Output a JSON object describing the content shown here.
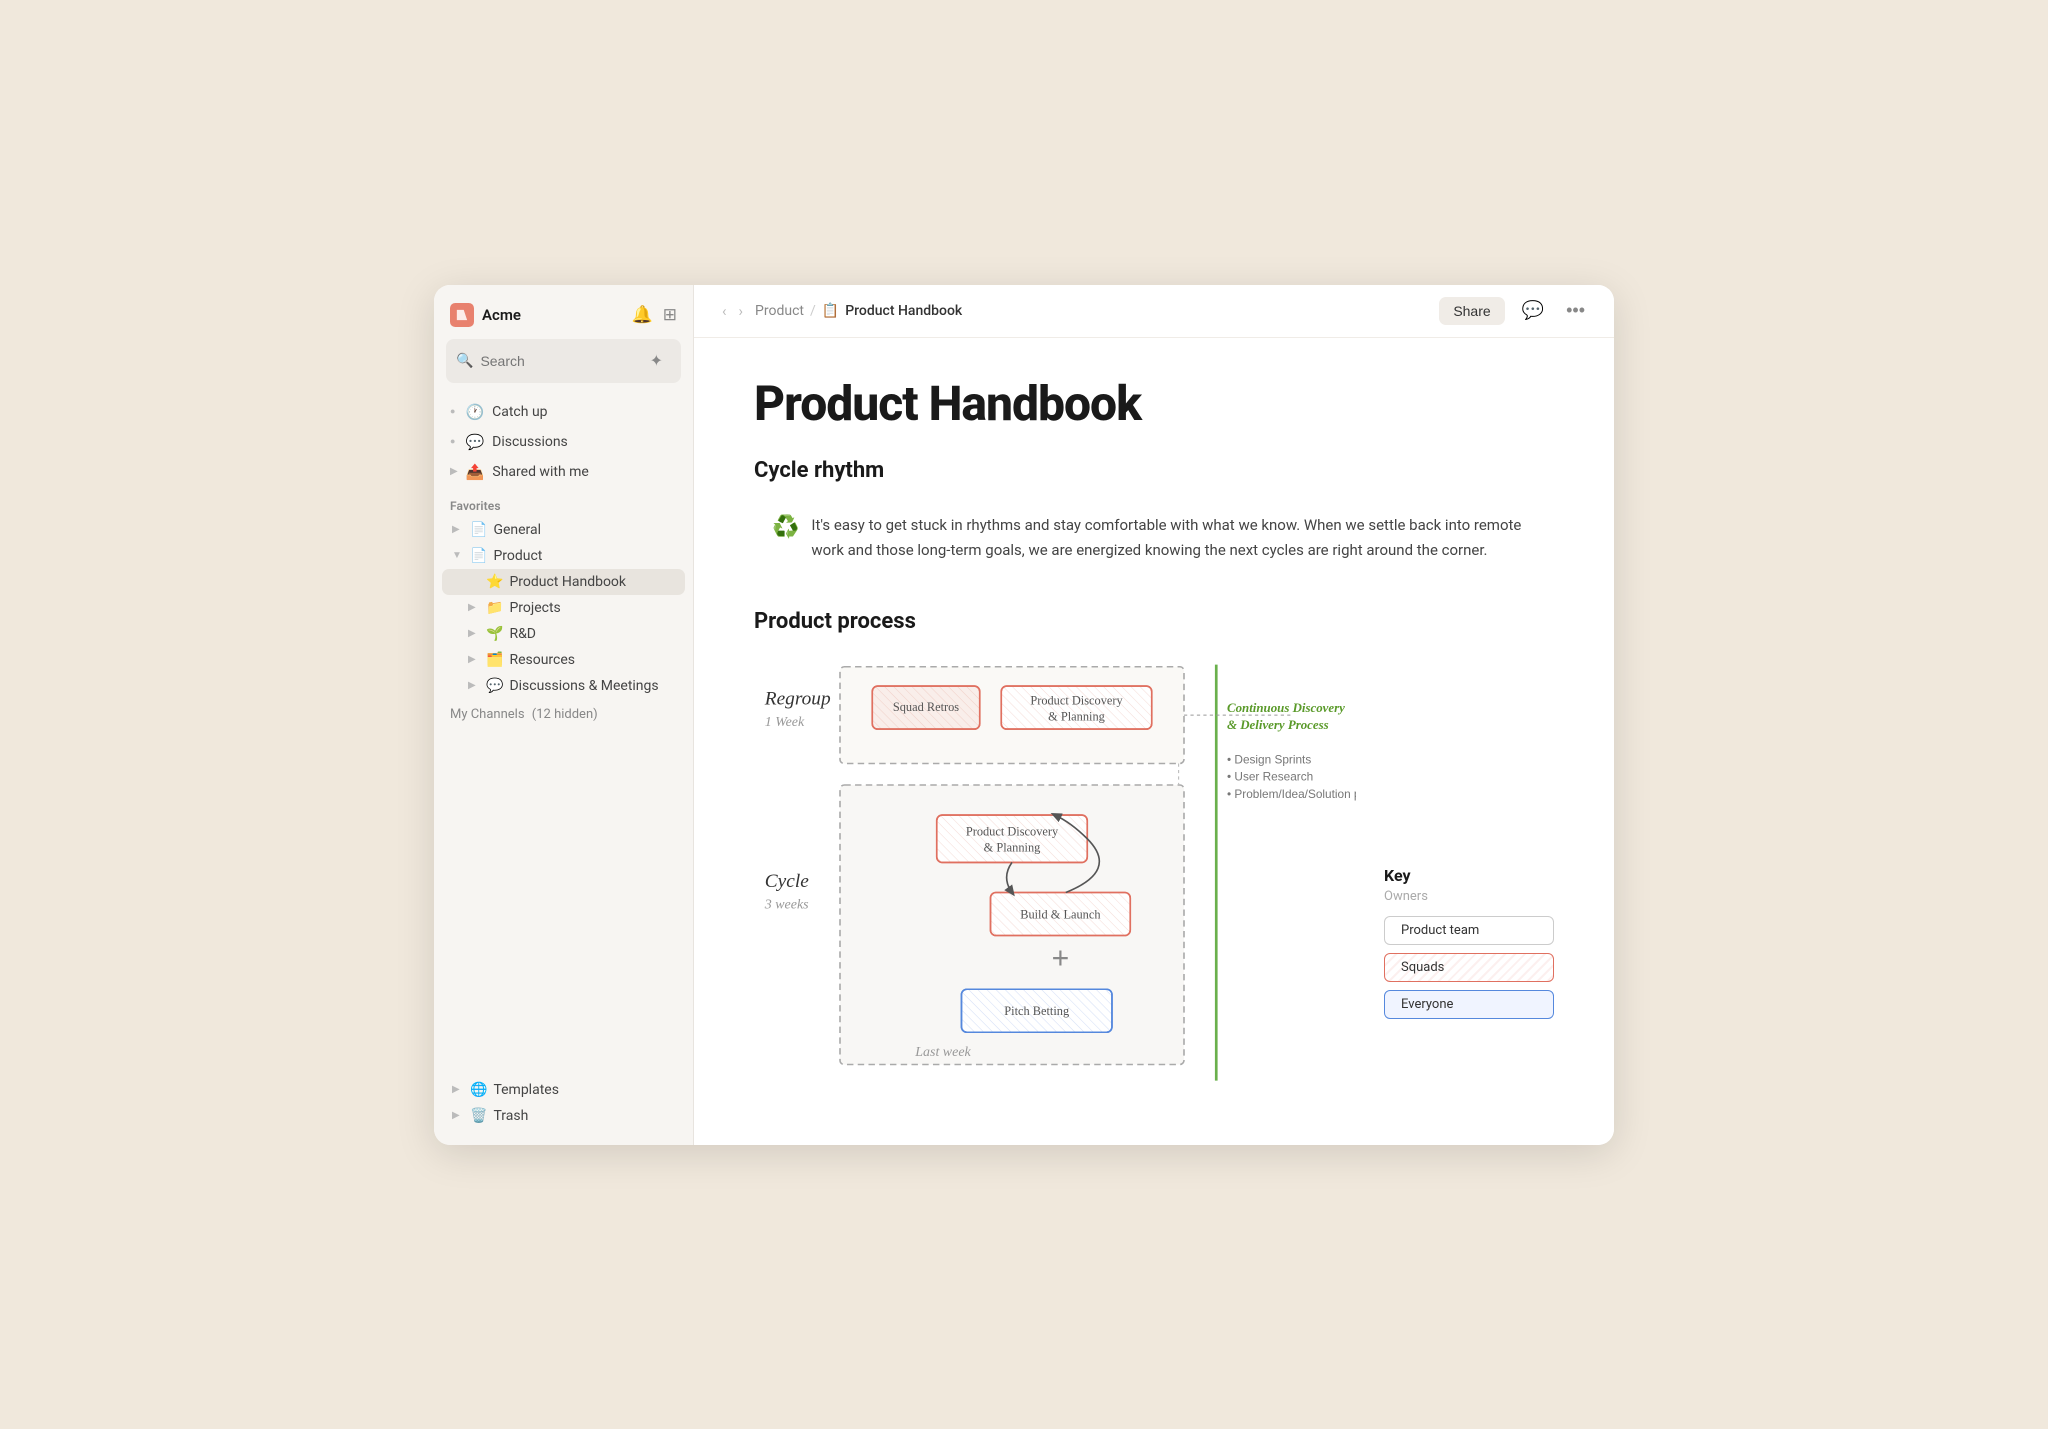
{
  "app": {
    "name": "Acme",
    "logo_emoji": "📋"
  },
  "sidebar": {
    "search_placeholder": "Search",
    "nav_items": [
      {
        "id": "catch-up",
        "icon": "🕐",
        "label": "Catch up"
      },
      {
        "id": "discussions",
        "icon": "💬",
        "label": "Discussions"
      },
      {
        "id": "shared",
        "icon": "📤",
        "label": "Shared with me"
      }
    ],
    "favorites_label": "Favorites",
    "favorites": [
      {
        "id": "general",
        "icon": "📄",
        "label": "General",
        "expanded": false
      },
      {
        "id": "product",
        "icon": "📄",
        "label": "Product",
        "expanded": true,
        "children": [
          {
            "id": "product-handbook",
            "icon": "⭐",
            "label": "Product Handbook",
            "active": true
          },
          {
            "id": "projects",
            "icon": "📁",
            "label": "Projects",
            "expanded": false
          },
          {
            "id": "rnd",
            "icon": "🌱",
            "label": "R&D",
            "expanded": false
          },
          {
            "id": "resources",
            "icon": "🗂️",
            "label": "Resources",
            "expanded": false
          },
          {
            "id": "discussions-meetings",
            "icon": "💬",
            "label": "Discussions & Meetings",
            "expanded": false
          }
        ]
      }
    ],
    "channels_label": "My Channels",
    "channels_hidden": "(12 hidden)",
    "bottom_items": [
      {
        "id": "templates",
        "icon": "🌐",
        "label": "Templates"
      },
      {
        "id": "trash",
        "icon": "🗑️",
        "label": "Trash"
      }
    ]
  },
  "topbar": {
    "breadcrumb_parent": "Product",
    "breadcrumb_separator": "/",
    "breadcrumb_icon": "📋",
    "breadcrumb_current": "Product Handbook",
    "share_label": "Share"
  },
  "document": {
    "title": "Product Handbook",
    "cycle_rhythm_heading": "Cycle rhythm",
    "callout_text": "It's easy to get stuck in rhythms and stay comfortable with what we know. When we settle back into remote work and those long-term goals, we are energized knowing the next cycles are right around the corner.",
    "process_heading": "Product process",
    "diagram": {
      "regroup_label": "Regroup",
      "regroup_duration": "1 Week",
      "cycle_label": "Cycle",
      "cycle_duration": "3 weeks",
      "last_week_label": "Last week",
      "squad_retros": "Squad Retros",
      "product_discovery": "Product Discovery & Planning",
      "build_launch": "Build & Launch",
      "pitch_betting": "Pitch Betting",
      "continuous_label": "Continuous Discovery",
      "continuous_label2": "& Delivery Process",
      "design_sprints": "• Design Sprints",
      "user_research": "• User Research",
      "problem_ideas": "• Problem/Idea/Solution proposals"
    },
    "key": {
      "title": "Key",
      "subtitle": "Owners",
      "badges": [
        {
          "label": "Product team",
          "style": "plain"
        },
        {
          "label": "Squads",
          "style": "red"
        },
        {
          "label": "Everyone",
          "style": "blue"
        }
      ]
    }
  }
}
